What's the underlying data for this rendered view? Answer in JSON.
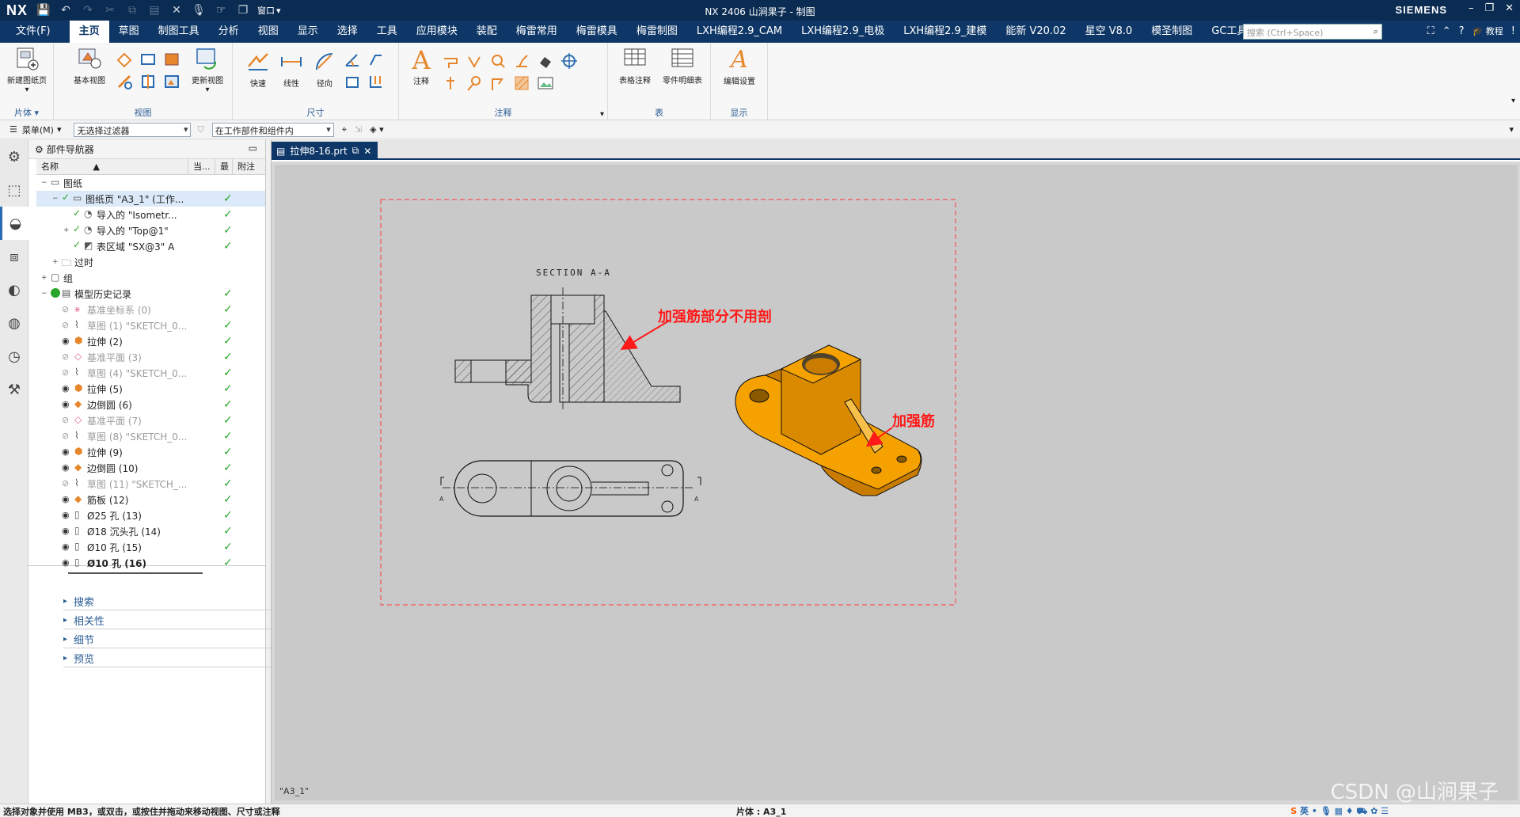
{
  "titlebar": {
    "logo": "NX",
    "window_menu": "窗口",
    "title": "NX 2406 山涧果子 - 制图",
    "brand": "SIEMENS"
  },
  "menubar": {
    "items": [
      "文件(F)",
      "主页",
      "草图",
      "制图工具",
      "分析",
      "视图",
      "显示",
      "选择",
      "工具",
      "应用模块",
      "装配",
      "梅雷常用",
      "梅雷模具",
      "梅雷制图",
      "LXH编程2.9_CAM",
      "LXH编程2.9_电极",
      "LXH编程2.9_建模",
      "能新 V20.02",
      "星空 V8.0",
      "模圣制图",
      "GC工具箱"
    ],
    "active": "主页",
    "search_placeholder": "搜索 (Ctrl+Space)",
    "tutorial": "教程"
  },
  "ribbon": {
    "groups": {
      "sheet": {
        "label": "片体",
        "new_sheet": "新建图纸页"
      },
      "view": {
        "label": "视图",
        "base_view": "基本视图",
        "update_view": "更新视图"
      },
      "dimension": {
        "label": "尺寸",
        "rapid": "快速",
        "linear": "线性",
        "radial": "径向"
      },
      "annotation": {
        "label": "注释",
        "note": "注释"
      },
      "table": {
        "label": "表",
        "tabular_note": "表格注释",
        "parts_list": "零件明细表"
      },
      "display": {
        "label": "显示",
        "edit_settings": "编辑设置"
      }
    }
  },
  "toolrow": {
    "menu": "菜单(M)",
    "filter": "无选择过滤器",
    "scope": "在工作部件和组件内"
  },
  "navigator": {
    "title": "部件导航器",
    "columns": [
      "名称",
      "当...",
      "最",
      "附注"
    ],
    "rows": [
      {
        "label": "图纸",
        "indent": 0,
        "ex": "−",
        "check": "",
        "dim": false,
        "bold": false,
        "icon": "drawing-icon"
      },
      {
        "label": "图纸页 \"A3_1\" (工作...",
        "indent": 1,
        "ex": "−",
        "check": "✓",
        "dim": false,
        "bold": false,
        "icon": "sheet-icon",
        "selected": true
      },
      {
        "label": "导入的 \"Isometr...",
        "indent": 2,
        "ex": "",
        "check": "✓",
        "dim": false,
        "bold": false,
        "icon": "view-icon"
      },
      {
        "label": "导入的 \"Top@1\"",
        "indent": 2,
        "ex": "+",
        "check": "✓",
        "dim": false,
        "bold": false,
        "icon": "view-icon"
      },
      {
        "label": "表区域 \"SX@3\" A",
        "indent": 2,
        "ex": "",
        "check": "✓",
        "dim": false,
        "bold": false,
        "icon": "section-icon"
      },
      {
        "label": "过时",
        "indent": 1,
        "ex": "+",
        "check": "",
        "dim": false,
        "bold": false,
        "icon": "folder-icon"
      },
      {
        "label": "组",
        "indent": 0,
        "ex": "+",
        "check": "",
        "dim": false,
        "bold": false,
        "icon": "group-icon"
      },
      {
        "label": "模型历史记录",
        "indent": 0,
        "ex": "−",
        "check": "✓",
        "dim": false,
        "bold": false,
        "icon": "history-icon"
      },
      {
        "label": "基准坐标系 (0)",
        "indent": 1,
        "ex": "",
        "check": "✓",
        "dim": true,
        "bold": false,
        "icon": "csys-icon"
      },
      {
        "label": "草图 (1) \"SKETCH_0...",
        "indent": 1,
        "ex": "",
        "check": "✓",
        "dim": true,
        "bold": false,
        "icon": "sketch-icon"
      },
      {
        "label": "拉伸 (2)",
        "indent": 1,
        "ex": "",
        "check": "✓",
        "dim": false,
        "bold": false,
        "icon": "extrude-icon"
      },
      {
        "label": "基准平面 (3)",
        "indent": 1,
        "ex": "",
        "check": "✓",
        "dim": true,
        "bold": false,
        "icon": "plane-icon"
      },
      {
        "label": "草图 (4) \"SKETCH_0...",
        "indent": 1,
        "ex": "",
        "check": "✓",
        "dim": true,
        "bold": false,
        "icon": "sketch-icon"
      },
      {
        "label": "拉伸 (5)",
        "indent": 1,
        "ex": "",
        "check": "✓",
        "dim": false,
        "bold": false,
        "icon": "extrude-icon"
      },
      {
        "label": "边倒圆 (6)",
        "indent": 1,
        "ex": "",
        "check": "✓",
        "dim": false,
        "bold": false,
        "icon": "blend-icon"
      },
      {
        "label": "基准平面 (7)",
        "indent": 1,
        "ex": "",
        "check": "✓",
        "dim": true,
        "bold": false,
        "icon": "plane-icon"
      },
      {
        "label": "草图 (8) \"SKETCH_0...",
        "indent": 1,
        "ex": "",
        "check": "✓",
        "dim": true,
        "bold": false,
        "icon": "sketch-icon"
      },
      {
        "label": "拉伸 (9)",
        "indent": 1,
        "ex": "",
        "check": "✓",
        "dim": false,
        "bold": false,
        "icon": "extrude-icon"
      },
      {
        "label": "边倒圆 (10)",
        "indent": 1,
        "ex": "",
        "check": "✓",
        "dim": false,
        "bold": false,
        "icon": "blend-icon"
      },
      {
        "label": "草图 (11) \"SKETCH_...",
        "indent": 1,
        "ex": "",
        "check": "✓",
        "dim": true,
        "bold": false,
        "icon": "sketch-icon"
      },
      {
        "label": "筋板 (12)",
        "indent": 1,
        "ex": "",
        "check": "✓",
        "dim": false,
        "bold": false,
        "icon": "rib-icon"
      },
      {
        "label": "Ø25 孔 (13)",
        "indent": 1,
        "ex": "",
        "check": "✓",
        "dim": false,
        "bold": false,
        "icon": "hole-icon"
      },
      {
        "label": "Ø18 沉头孔 (14)",
        "indent": 1,
        "ex": "",
        "check": "✓",
        "dim": false,
        "bold": false,
        "icon": "hole-icon"
      },
      {
        "label": "Ø10 孔 (15)",
        "indent": 1,
        "ex": "",
        "check": "✓",
        "dim": false,
        "bold": false,
        "icon": "hole-icon"
      },
      {
        "label": "Ø10 孔 (16)",
        "indent": 1,
        "ex": "",
        "check": "✓",
        "dim": false,
        "bold": true,
        "icon": "hole-icon"
      }
    ],
    "panels": [
      "搜索",
      "相关性",
      "细节",
      "预览"
    ]
  },
  "graphics": {
    "tab": "拉伸8-16.prt",
    "sheet_name": "\"A3_1\"",
    "section_title": "SECTION  A-A",
    "section_marks": [
      "A",
      "A"
    ],
    "callout_rib_not_cut": "加强筋部分不用剖",
    "callout_rib": "加强筋",
    "colors": {
      "callout": "#ff1a1a",
      "part": "#f5a100",
      "part_dark": "#c97c00",
      "border": "#ff3b3b"
    }
  },
  "statusbar": {
    "prompt": "选择对象并使用 MB3，或双击，或按住并拖动来移动视图、尺寸或注释",
    "sheet": "片体 : A3_1",
    "watermark": "CSDN @山涧果子",
    "ime": "英"
  }
}
